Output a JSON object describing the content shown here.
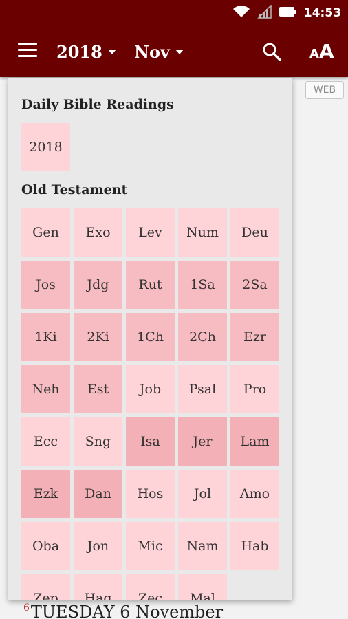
{
  "status_bar": {
    "time": "14:53",
    "icons": [
      "wifi-icon",
      "cell-signal-icon",
      "battery-icon"
    ]
  },
  "app_bar": {
    "menu_icon": "hamburger-menu-icon",
    "year": "2018",
    "month": "Nov",
    "search_icon": "search-icon",
    "font_size_icon": "font-size-icon",
    "font_small": "A",
    "font_big": "A",
    "color": "#6b0000"
  },
  "background": {
    "web_badge": "WEB",
    "date_num": "6",
    "date_text": "TUESDAY 6 November"
  },
  "panel": {
    "title": "Daily Bible Readings",
    "year_tile": "2018",
    "section_title": "Old Testament",
    "books": [
      {
        "name": "Gen",
        "color": "#ffd4d9"
      },
      {
        "name": "Exo",
        "color": "#ffd4d9"
      },
      {
        "name": "Lev",
        "color": "#ffd4d9"
      },
      {
        "name": "Num",
        "color": "#ffd4d9"
      },
      {
        "name": "Deu",
        "color": "#ffd4d9"
      },
      {
        "name": "Jos",
        "color": "#f7bcc2"
      },
      {
        "name": "Jdg",
        "color": "#f7bcc2"
      },
      {
        "name": "Rut",
        "color": "#f7bcc2"
      },
      {
        "name": "1Sa",
        "color": "#f7bcc2"
      },
      {
        "name": "2Sa",
        "color": "#f7bcc2"
      },
      {
        "name": "1Ki",
        "color": "#f7bcc2"
      },
      {
        "name": "2Ki",
        "color": "#f7bcc2"
      },
      {
        "name": "1Ch",
        "color": "#f7bcc2"
      },
      {
        "name": "2Ch",
        "color": "#f7bcc2"
      },
      {
        "name": "Ezr",
        "color": "#f7bcc2"
      },
      {
        "name": "Neh",
        "color": "#f7bcc2"
      },
      {
        "name": "Est",
        "color": "#f7bcc2"
      },
      {
        "name": "Job",
        "color": "#ffd4d9"
      },
      {
        "name": "Psal",
        "color": "#ffd4d9"
      },
      {
        "name": "Pro",
        "color": "#ffd4d9"
      },
      {
        "name": "Ecc",
        "color": "#ffd4d9"
      },
      {
        "name": "Sng",
        "color": "#ffd4d9"
      },
      {
        "name": "Isa",
        "color": "#f3b0b6"
      },
      {
        "name": "Jer",
        "color": "#f3b0b6"
      },
      {
        "name": "Lam",
        "color": "#f3b0b6"
      },
      {
        "name": "Ezk",
        "color": "#f3b0b6"
      },
      {
        "name": "Dan",
        "color": "#f3b0b6"
      },
      {
        "name": "Hos",
        "color": "#ffd4d9"
      },
      {
        "name": "Jol",
        "color": "#ffd4d9"
      },
      {
        "name": "Amo",
        "color": "#ffd4d9"
      },
      {
        "name": "Oba",
        "color": "#ffd4d9"
      },
      {
        "name": "Jon",
        "color": "#ffd4d9"
      },
      {
        "name": "Mic",
        "color": "#ffd4d9"
      },
      {
        "name": "Nam",
        "color": "#ffd4d9"
      },
      {
        "name": "Hab",
        "color": "#ffd4d9"
      },
      {
        "name": "Zep",
        "color": "#ffd4d9"
      },
      {
        "name": "Hag",
        "color": "#ffd4d9"
      },
      {
        "name": "Zec",
        "color": "#ffd4d9"
      },
      {
        "name": "Mal",
        "color": "#ffd4d9"
      }
    ]
  }
}
